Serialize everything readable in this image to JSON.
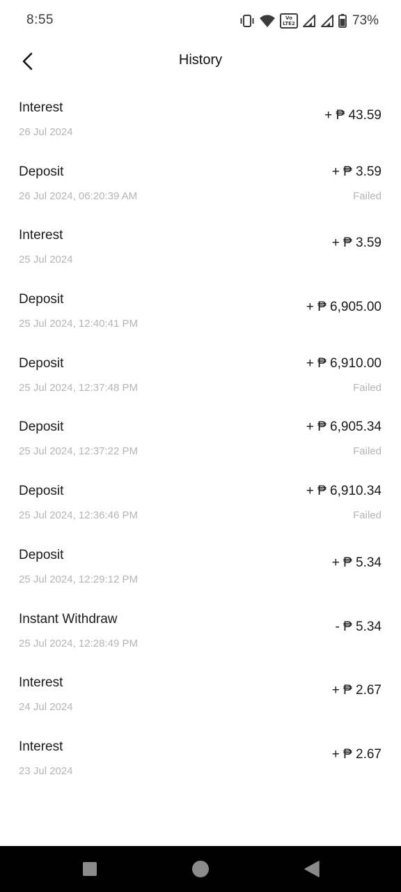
{
  "status_bar": {
    "time": "8:55",
    "battery": "73%",
    "volte_top": "Vo",
    "volte_bottom": "LTE2"
  },
  "header": {
    "title": "History"
  },
  "transactions": [
    {
      "title": "Interest",
      "date": "26 Jul 2024",
      "amount": "+ ₱ 43.59",
      "status": ""
    },
    {
      "title": "Deposit",
      "date": "26 Jul 2024, 06:20:39 AM",
      "amount": "+ ₱ 3.59",
      "status": "Failed"
    },
    {
      "title": "Interest",
      "date": "25 Jul 2024",
      "amount": "+ ₱ 3.59",
      "status": ""
    },
    {
      "title": "Deposit",
      "date": "25 Jul 2024, 12:40:41 PM",
      "amount": "+ ₱ 6,905.00",
      "status": ""
    },
    {
      "title": "Deposit",
      "date": "25 Jul 2024, 12:37:48 PM",
      "amount": "+ ₱ 6,910.00",
      "status": "Failed"
    },
    {
      "title": "Deposit",
      "date": "25 Jul 2024, 12:37:22 PM",
      "amount": "+ ₱ 6,905.34",
      "status": "Failed"
    },
    {
      "title": "Deposit",
      "date": "25 Jul 2024, 12:36:46 PM",
      "amount": "+ ₱ 6,910.34",
      "status": "Failed"
    },
    {
      "title": "Deposit",
      "date": "25 Jul 2024, 12:29:12 PM",
      "amount": "+ ₱ 5.34",
      "status": ""
    },
    {
      "title": "Instant Withdraw",
      "date": "25 Jul 2024, 12:28:49 PM",
      "amount": "- ₱ 5.34",
      "status": ""
    },
    {
      "title": "Interest",
      "date": "24 Jul 2024",
      "amount": "+ ₱ 2.67",
      "status": ""
    },
    {
      "title": "Interest",
      "date": "23 Jul 2024",
      "amount": "+ ₱ 2.67",
      "status": ""
    }
  ],
  "colors": {
    "text_primary": "#1a1a1a",
    "text_secondary": "#b5b5b5",
    "nav_bar": "#000000",
    "nav_icon": "#8a8a8a"
  },
  "icons": {
    "back": "chevron-left-icon",
    "vibrate": "vibrate-icon",
    "wifi": "wifi-icon",
    "signal": "signal-icon",
    "battery": "battery-icon",
    "nav_recents": "square-icon",
    "nav_home": "circle-icon",
    "nav_back": "triangle-icon"
  }
}
